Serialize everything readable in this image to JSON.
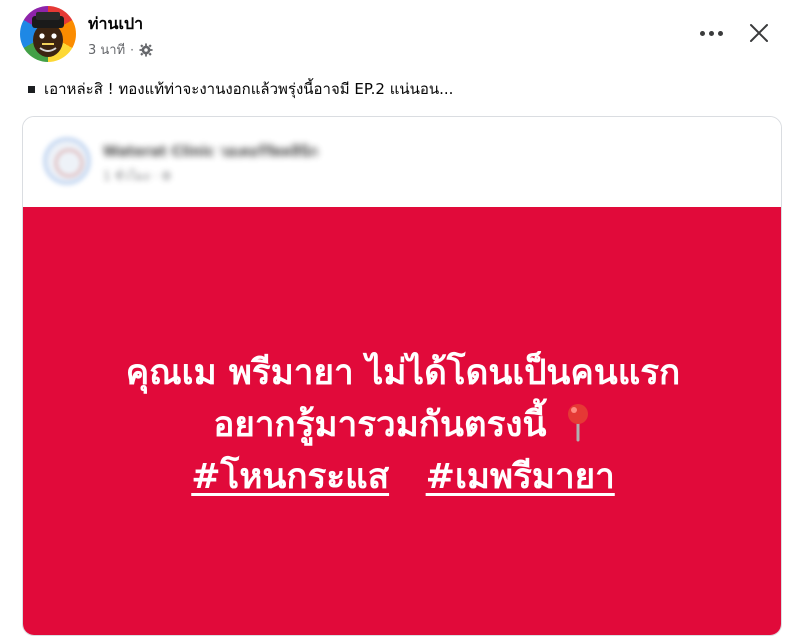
{
  "post": {
    "author_name": "ท่านเปา",
    "time_ago": "3 นาที",
    "meta_separator": "·",
    "privacy_icon": "gear-icon",
    "caption": "เอาหล่ะสิ ! ทองแท้ท่าจะงานงอกแล้วพรุ่งนี้อาจมี EP.2 แน่นอน...",
    "more_icon": "more-dots-icon",
    "close_icon": "close-icon"
  },
  "shared_post": {
    "author_name_blurred": "Waterat Clinic วอเตอร์รัตคลินิก",
    "meta_blurred": "1 ชั่วโมง · ⚙",
    "banner_color": "#e10a3a",
    "banner_line1": "คุณเม พรีมายา ไม่ได้โดนเป็นคนแรก",
    "banner_line2": "อยากรู้มารวมกันตรงนี้",
    "pin_icon": "round-pushpin-icon",
    "hashtag1": "#โหนกระแส",
    "hashtag2": "#เมพรีมายา"
  }
}
